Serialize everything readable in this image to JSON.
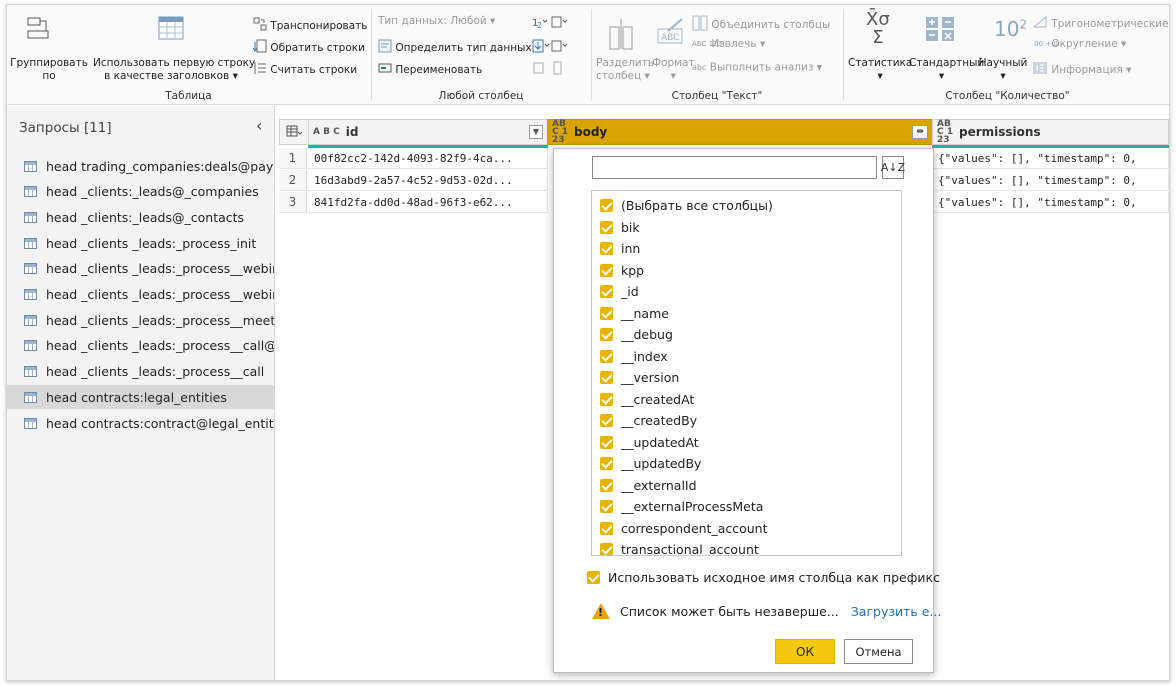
{
  "ribbon": {
    "table_group": {
      "label": "Таблица",
      "group_by_line1": "Группировать",
      "group_by_line2": "по",
      "use_first_row_line1": "Использовать первую строку",
      "use_first_row_line2": "в качестве заголовков",
      "transpose": "Транспонировать",
      "reverse_rows": "Обратить строки",
      "count_rows": "Считать строки"
    },
    "any_column_group": {
      "label": "Любой столбец",
      "data_type": "Тип данных: Любой",
      "detect_type": "Определить тип данных",
      "rename": "Переименовать"
    },
    "text_column_group": {
      "label": "Столбец \"Текст\"",
      "split_column_line1": "Разделить",
      "split_column_line2": "столбец",
      "format": "Формат",
      "merge_columns": "Объединить столбцы",
      "extract": "Извлечь",
      "parse": "Выполнить анализ",
      "abc_badge": "ABC",
      "abc_123_badge": "ABC 123",
      "abc_small_badge": "abc"
    },
    "number_column_group": {
      "label": "Столбец \"Количество\"",
      "statistics": "Статистика",
      "standard": "Стандартный",
      "scientific": "Научный",
      "trigonometry": "Тригонометрические",
      "rounding": "Округление",
      "information": "Информация",
      "sigma_symbol": "X̄σ",
      "sum_symbol": "Σ",
      "power_base": "10",
      "power_exp": "2",
      "rounding_badge": ".00 +.0"
    }
  },
  "queries": {
    "title": "Запросы [11]",
    "items": [
      "head trading_companies:deals@paym...",
      "head _clients:_leads@_companies",
      "head _clients:_leads@_contacts",
      "head _clients _leads:_process_init",
      "head _clients _leads:_process__webina...",
      "head _clients _leads:_process__webinar",
      "head _clients _leads:_process__meeting",
      "head _clients _leads:_process__call@_l...",
      "head _clients _leads:_process__call",
      "head contracts:legal_entities",
      "head contracts:contract@legal_entity"
    ],
    "selected_index": 9
  },
  "grid": {
    "columns": [
      {
        "type": "A B C",
        "name": "id"
      },
      {
        "type": "ABC 123",
        "name": "body"
      },
      {
        "type": "ABC 123",
        "name": "permissions"
      }
    ],
    "rows": [
      {
        "num": "1",
        "id": "00f82cc2-142d-4093-82f9-4ca...",
        "permissions": "{\"values\": [], \"timestamp\": 0,"
      },
      {
        "num": "2",
        "id": "16d3abd9-2a57-4c52-9d53-02d...",
        "permissions": "{\"values\": [], \"timestamp\": 0,"
      },
      {
        "num": "3",
        "id": "841fd2fa-dd0d-48ad-96f3-e62...",
        "permissions": "{\"values\": [], \"timestamp\": 0,"
      }
    ]
  },
  "popup": {
    "search_value": "",
    "sort_label": "A↓Z",
    "options": [
      "(Выбрать все столбцы)",
      "bik",
      "inn",
      "kpp",
      "_id",
      "__name",
      "__debug",
      "__index",
      "__version",
      "__createdAt",
      "__createdBy",
      "__updatedAt",
      "__updatedBy",
      "__externalId",
      "__externalProcessMeta",
      "correspondent_account",
      "transactional_account"
    ],
    "prefix_label": "Использовать исходное имя столбца как префикс",
    "warning_text": "Список может быть незаверше...",
    "load_more": "Загрузить е...",
    "ok": "ОК",
    "cancel": "Отмена"
  },
  "colors": {
    "accent": "#f2c811",
    "header_selected": "#d9a400",
    "teal": "#1fb3a6",
    "link": "#1f6fbf"
  }
}
